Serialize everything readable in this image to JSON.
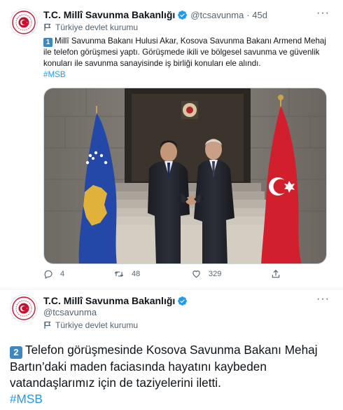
{
  "tweet1": {
    "author_name": "T.C. Millî Savunma Bakanlığı",
    "handle": "@tcsavunma",
    "time": "· 45d",
    "gov_label": "Türkiye devlet kurumu",
    "keycap": "1",
    "text": "Millî Savunma Bakanı Hulusi Akar, Kosova Savunma Bakanı Armend Mehaj ile telefon görüşmesi yaptı. Görüşmede ikili ve bölgesel savunma ve güvenlik konuları ile savunma sanayisinde iş birliği konuları ele alındı.",
    "hashtag": "#MSB",
    "actions": {
      "replies": "4",
      "retweets": "48",
      "likes": "329"
    }
  },
  "tweet2": {
    "author_name": "T.C. Millî Savunma Bakanlığı",
    "handle": "@tcsavunma",
    "gov_label": "Türkiye devlet kurumu",
    "keycap": "2",
    "text": "Telefon görüşmesinde Kosova Savunma Bakanı Mehaj Bartın’daki maden faciasında hayatını kaybeden vatandaşlarımız için de taziyelerini iletti.",
    "hashtag": "#MSB"
  },
  "colors": {
    "accent": "#1d9bf0",
    "secondary_text": "#536471",
    "keycap": "#3b88c3"
  },
  "icons": [
    "msb-emblem-icon",
    "verified-badge-icon",
    "flag-label-icon",
    "more-icon",
    "reply-icon",
    "retweet-icon",
    "like-icon",
    "share-icon"
  ]
}
